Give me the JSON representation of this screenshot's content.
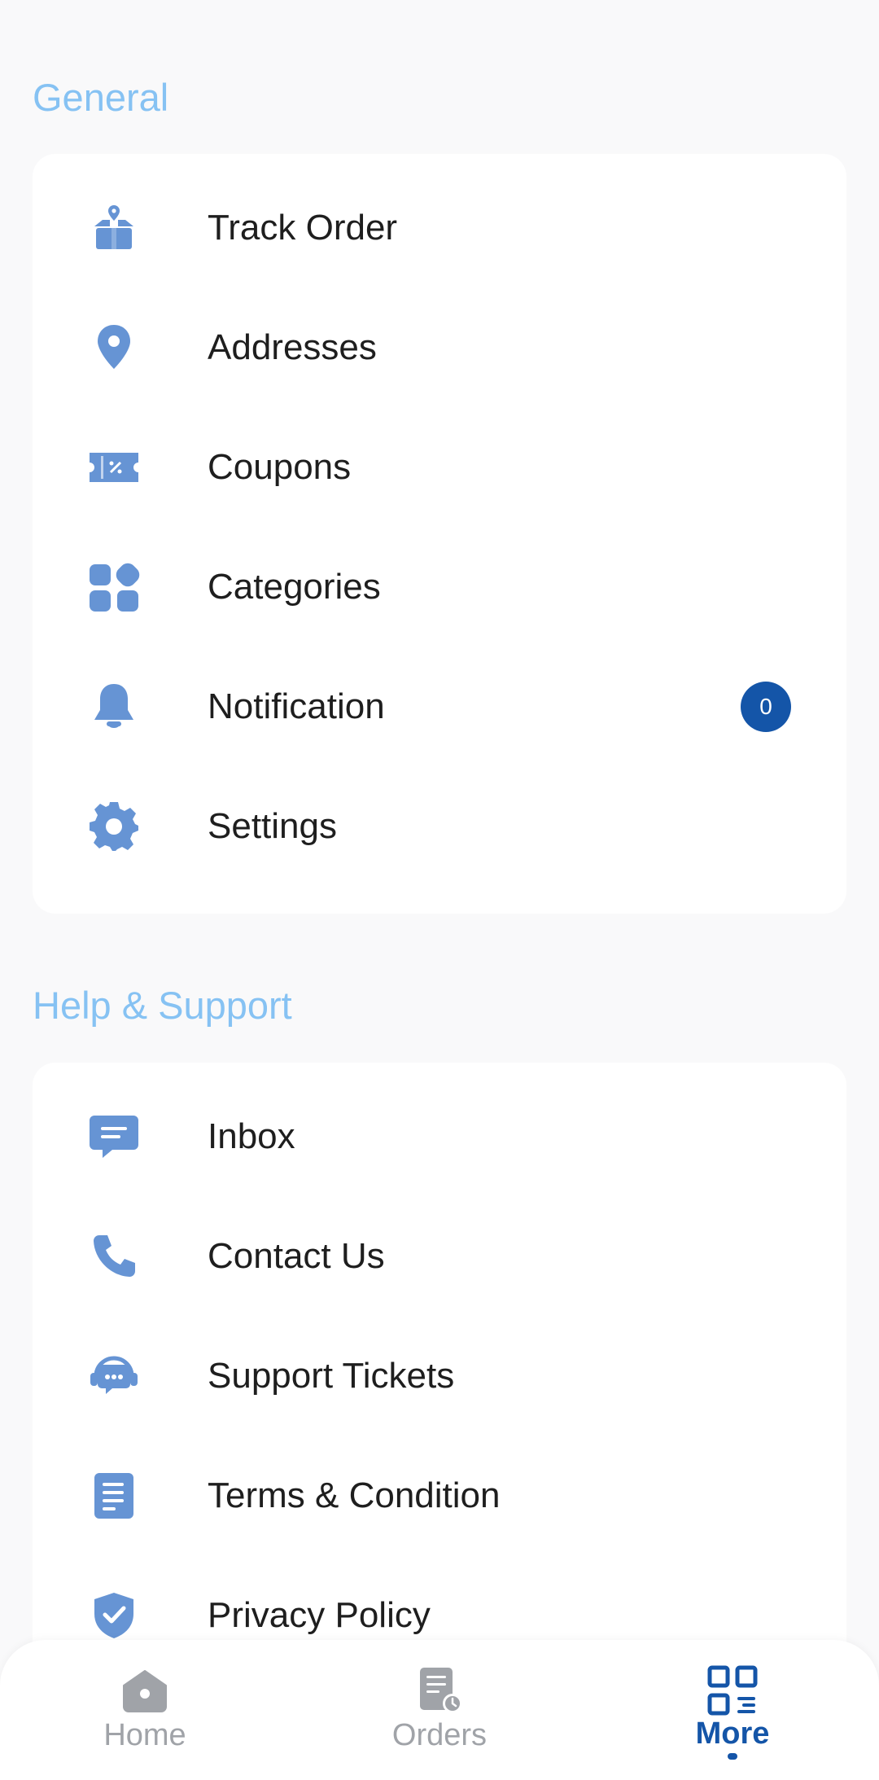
{
  "colors": {
    "background": "#f9f9fa",
    "section_title": "#86c2f3",
    "icon": "#6694d4",
    "badge": "#1455a8",
    "nav_active": "#1455a8",
    "nav_inactive": "#a0a3a8"
  },
  "general": {
    "title": "General",
    "items": [
      {
        "label": "Track Order",
        "icon": "track-order-icon"
      },
      {
        "label": "Addresses",
        "icon": "location-pin-icon"
      },
      {
        "label": "Coupons",
        "icon": "coupon-icon"
      },
      {
        "label": "Categories",
        "icon": "categories-icon"
      },
      {
        "label": "Notification",
        "icon": "bell-icon",
        "badge": "0"
      },
      {
        "label": "Settings",
        "icon": "gear-icon"
      }
    ]
  },
  "help": {
    "title": "Help & Support",
    "items": [
      {
        "label": "Inbox",
        "icon": "chat-icon"
      },
      {
        "label": "Contact Us",
        "icon": "phone-icon"
      },
      {
        "label": "Support Tickets",
        "icon": "support-headset-icon"
      },
      {
        "label": "Terms & Condition",
        "icon": "document-icon"
      },
      {
        "label": "Privacy Policy",
        "icon": "shield-check-icon"
      }
    ]
  },
  "bottom_nav": {
    "items": [
      {
        "label": "Home",
        "icon": "home-icon",
        "active": false
      },
      {
        "label": "Orders",
        "icon": "orders-icon",
        "active": false
      },
      {
        "label": "More",
        "icon": "more-grid-icon",
        "active": true
      }
    ]
  }
}
